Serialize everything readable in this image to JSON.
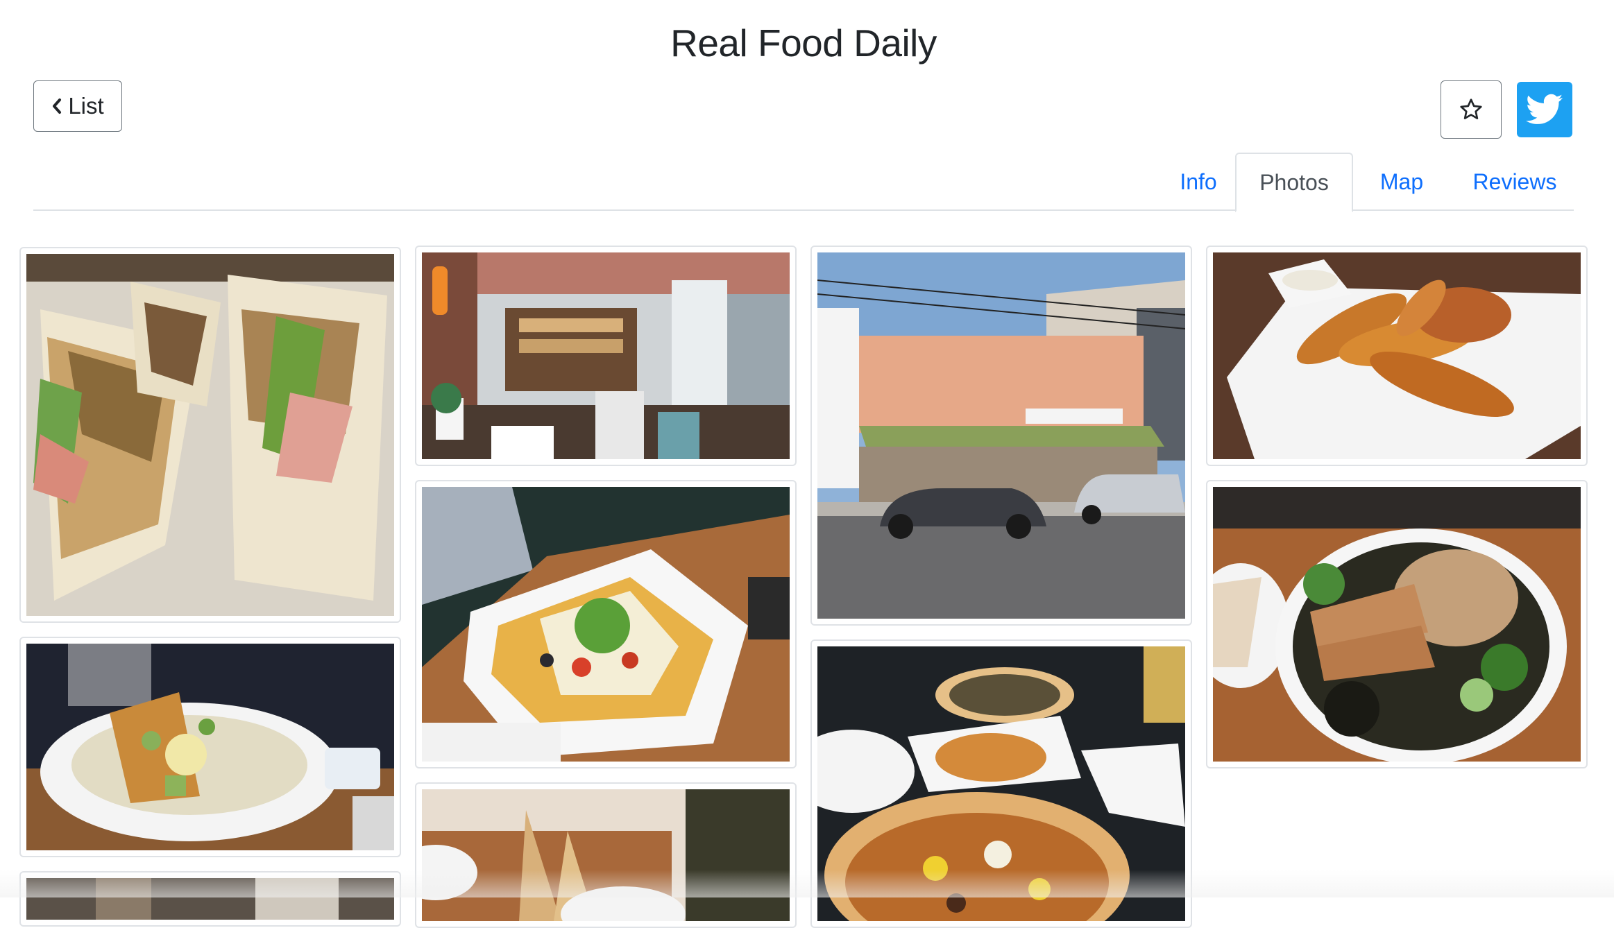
{
  "header": {
    "title": "Real Food Daily",
    "back_label": "List"
  },
  "actions": {
    "favorite_icon": "star-outline-icon",
    "share_icon": "twitter-icon",
    "twitter_color": "#1da1f2"
  },
  "tabs": [
    {
      "label": "Info",
      "active": false
    },
    {
      "label": "Photos",
      "active": true
    },
    {
      "label": "Map",
      "active": false
    },
    {
      "label": "Reviews",
      "active": false
    }
  ],
  "colors": {
    "link": "#0d6efd",
    "active_tab_text": "#495057",
    "border": "#dee2e6"
  },
  "photos": [
    {
      "subject": "club sandwich"
    },
    {
      "subject": "taco plate"
    },
    {
      "subject": "restaurant interior"
    },
    {
      "subject": "nachos"
    },
    {
      "subject": "flatbread"
    },
    {
      "subject": "storefront"
    },
    {
      "subject": "pizza table"
    },
    {
      "subject": "potato wedges"
    },
    {
      "subject": "grain bowl"
    },
    {
      "subject": "partial photo"
    }
  ]
}
